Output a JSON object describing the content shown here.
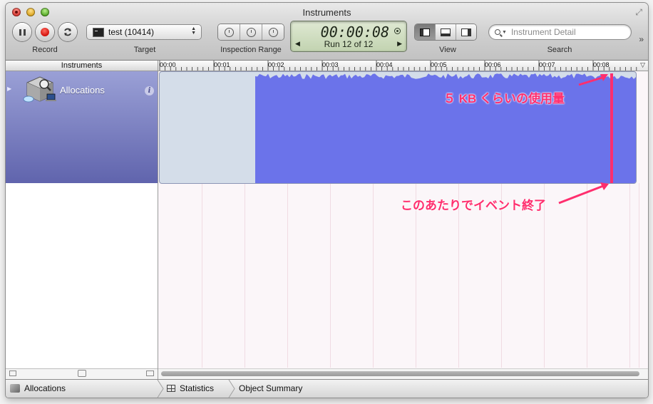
{
  "window": {
    "title": "Instruments"
  },
  "toolbar": {
    "record_label": "Record",
    "target_label": "Target",
    "target_value": "test (10414)",
    "inspection_range_label": "Inspection Range",
    "timer": "00:00:08",
    "run_text": "Run 12 of 12",
    "view_label": "View",
    "search_label": "Search",
    "search_placeholder": "Instrument Detail"
  },
  "sidebar": {
    "header": "Instruments",
    "instrument_name": "Allocations"
  },
  "timeline": {
    "ticks": [
      "00:00",
      "00:01",
      "00:02",
      "00:03",
      "00:04",
      "00:05",
      "00:06",
      "00:07",
      "00:08"
    ],
    "fill_color": "#6b73ea",
    "empty_color": "#d4dde9"
  },
  "annotations": {
    "usage": "５ KB くらいの使用量",
    "event_end": "このあたりでイベント終了",
    "color": "#ff2e6e"
  },
  "bottom_bar": {
    "instrument": "Allocations",
    "statistics": "Statistics",
    "object_summary": "Object Summary"
  }
}
